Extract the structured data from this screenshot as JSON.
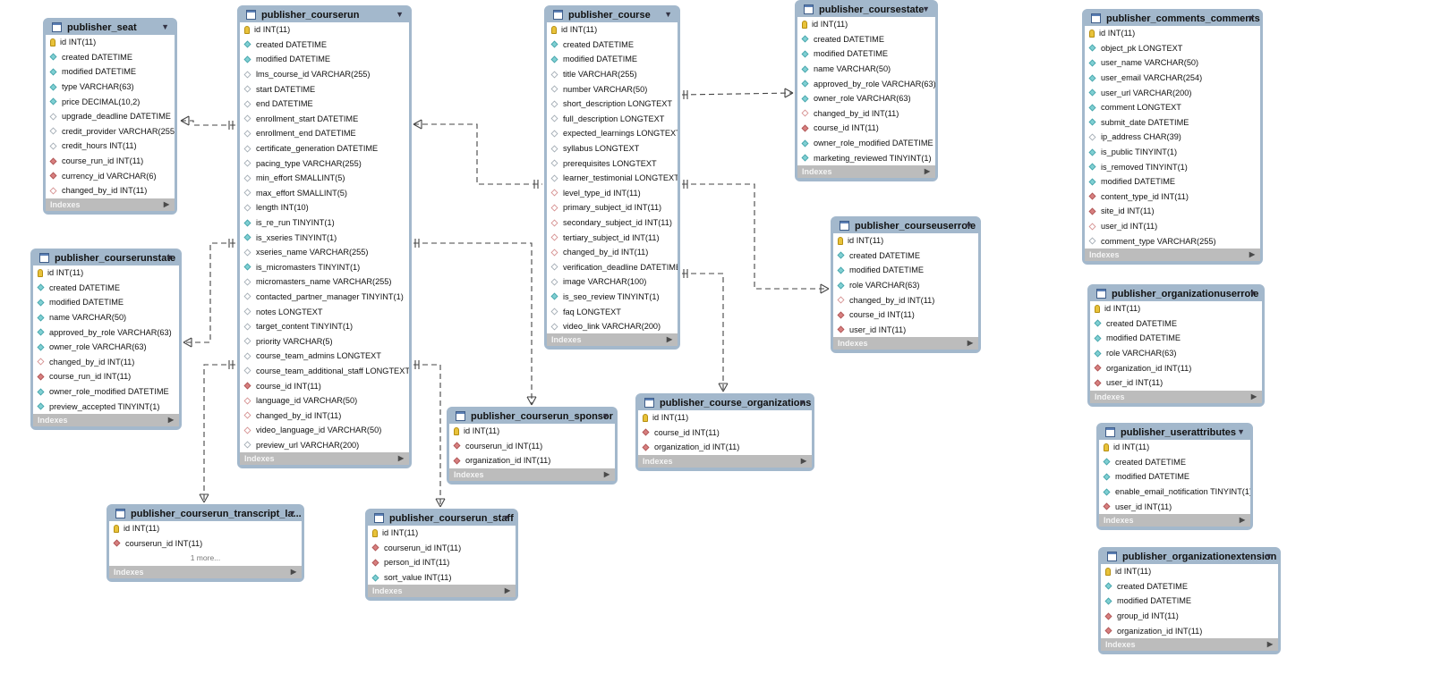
{
  "indexes_label": "Indexes",
  "tables": [
    {
      "id": "seat",
      "name": "publisher_seat",
      "columns": [
        {
          "t": "pk",
          "text": "id INT(11)"
        },
        {
          "t": "nn",
          "text": "created DATETIME"
        },
        {
          "t": "nn",
          "text": "modified DATETIME"
        },
        {
          "t": "nn",
          "text": "type VARCHAR(63)"
        },
        {
          "t": "nn",
          "text": "price DECIMAL(10,2)"
        },
        {
          "t": "col",
          "text": "upgrade_deadline DATETIME"
        },
        {
          "t": "col",
          "text": "credit_provider VARCHAR(255)"
        },
        {
          "t": "col",
          "text": "credit_hours INT(11)"
        },
        {
          "t": "fk",
          "text": "course_run_id INT(11)"
        },
        {
          "t": "fk",
          "text": "currency_id VARCHAR(6)"
        },
        {
          "t": "fkn",
          "text": "changed_by_id INT(11)"
        }
      ]
    },
    {
      "id": "courserun",
      "name": "publisher_courserun",
      "columns": [
        {
          "t": "pk",
          "text": "id INT(11)"
        },
        {
          "t": "nn",
          "text": "created DATETIME"
        },
        {
          "t": "nn",
          "text": "modified DATETIME"
        },
        {
          "t": "col",
          "text": "lms_course_id VARCHAR(255)"
        },
        {
          "t": "col",
          "text": "start DATETIME"
        },
        {
          "t": "col",
          "text": "end DATETIME"
        },
        {
          "t": "col",
          "text": "enrollment_start DATETIME"
        },
        {
          "t": "col",
          "text": "enrollment_end DATETIME"
        },
        {
          "t": "col",
          "text": "certificate_generation DATETIME"
        },
        {
          "t": "col",
          "text": "pacing_type VARCHAR(255)"
        },
        {
          "t": "col",
          "text": "min_effort SMALLINT(5)"
        },
        {
          "t": "col",
          "text": "max_effort SMALLINT(5)"
        },
        {
          "t": "col",
          "text": "length INT(10)"
        },
        {
          "t": "nn",
          "text": "is_re_run TINYINT(1)"
        },
        {
          "t": "nn",
          "text": "is_xseries TINYINT(1)"
        },
        {
          "t": "col",
          "text": "xseries_name VARCHAR(255)"
        },
        {
          "t": "nn",
          "text": "is_micromasters TINYINT(1)"
        },
        {
          "t": "col",
          "text": "micromasters_name VARCHAR(255)"
        },
        {
          "t": "col",
          "text": "contacted_partner_manager TINYINT(1)"
        },
        {
          "t": "col",
          "text": "notes LONGTEXT"
        },
        {
          "t": "col",
          "text": "target_content TINYINT(1)"
        },
        {
          "t": "col",
          "text": "priority VARCHAR(5)"
        },
        {
          "t": "col",
          "text": "course_team_admins LONGTEXT"
        },
        {
          "t": "col",
          "text": "course_team_additional_staff LONGTEXT"
        },
        {
          "t": "fk",
          "text": "course_id INT(11)"
        },
        {
          "t": "fkn",
          "text": "language_id VARCHAR(50)"
        },
        {
          "t": "fkn",
          "text": "changed_by_id INT(11)"
        },
        {
          "t": "fkn",
          "text": "video_language_id VARCHAR(50)"
        },
        {
          "t": "col",
          "text": "preview_url VARCHAR(200)"
        }
      ]
    },
    {
      "id": "course",
      "name": "publisher_course",
      "columns": [
        {
          "t": "pk",
          "text": "id INT(11)"
        },
        {
          "t": "nn",
          "text": "created DATETIME"
        },
        {
          "t": "nn",
          "text": "modified DATETIME"
        },
        {
          "t": "col",
          "text": "title VARCHAR(255)"
        },
        {
          "t": "col",
          "text": "number VARCHAR(50)"
        },
        {
          "t": "col",
          "text": "short_description LONGTEXT"
        },
        {
          "t": "col",
          "text": "full_description LONGTEXT"
        },
        {
          "t": "col",
          "text": "expected_learnings LONGTEXT"
        },
        {
          "t": "col",
          "text": "syllabus LONGTEXT"
        },
        {
          "t": "col",
          "text": "prerequisites LONGTEXT"
        },
        {
          "t": "col",
          "text": "learner_testimonial LONGTEXT"
        },
        {
          "t": "fkn",
          "text": "level_type_id INT(11)"
        },
        {
          "t": "fkn",
          "text": "primary_subject_id INT(11)"
        },
        {
          "t": "fkn",
          "text": "secondary_subject_id INT(11)"
        },
        {
          "t": "fkn",
          "text": "tertiary_subject_id INT(11)"
        },
        {
          "t": "fkn",
          "text": "changed_by_id INT(11)"
        },
        {
          "t": "col",
          "text": "verification_deadline DATETIME"
        },
        {
          "t": "col",
          "text": "image VARCHAR(100)"
        },
        {
          "t": "nn",
          "text": "is_seo_review TINYINT(1)"
        },
        {
          "t": "col",
          "text": "faq LONGTEXT"
        },
        {
          "t": "col",
          "text": "video_link VARCHAR(200)"
        }
      ]
    },
    {
      "id": "coursestate",
      "name": "publisher_coursestate",
      "columns": [
        {
          "t": "pk",
          "text": "id INT(11)"
        },
        {
          "t": "nn",
          "text": "created DATETIME"
        },
        {
          "t": "nn",
          "text": "modified DATETIME"
        },
        {
          "t": "nn",
          "text": "name VARCHAR(50)"
        },
        {
          "t": "nn",
          "text": "approved_by_role VARCHAR(63)"
        },
        {
          "t": "nn",
          "text": "owner_role VARCHAR(63)"
        },
        {
          "t": "fkn",
          "text": "changed_by_id INT(11)"
        },
        {
          "t": "fk",
          "text": "course_id INT(11)"
        },
        {
          "t": "nn",
          "text": "owner_role_modified DATETIME"
        },
        {
          "t": "nn",
          "text": "marketing_reviewed TINYINT(1)"
        }
      ]
    },
    {
      "id": "comments",
      "name": "publisher_comments_comments",
      "columns": [
        {
          "t": "pk",
          "text": "id INT(11)"
        },
        {
          "t": "nn",
          "text": "object_pk LONGTEXT"
        },
        {
          "t": "nn",
          "text": "user_name VARCHAR(50)"
        },
        {
          "t": "nn",
          "text": "user_email VARCHAR(254)"
        },
        {
          "t": "nn",
          "text": "user_url VARCHAR(200)"
        },
        {
          "t": "nn",
          "text": "comment LONGTEXT"
        },
        {
          "t": "nn",
          "text": "submit_date DATETIME"
        },
        {
          "t": "col",
          "text": "ip_address CHAR(39)"
        },
        {
          "t": "nn",
          "text": "is_public TINYINT(1)"
        },
        {
          "t": "nn",
          "text": "is_removed TINYINT(1)"
        },
        {
          "t": "nn",
          "text": "modified DATETIME"
        },
        {
          "t": "fk",
          "text": "content_type_id INT(11)"
        },
        {
          "t": "fk",
          "text": "site_id INT(11)"
        },
        {
          "t": "fkn",
          "text": "user_id INT(11)"
        },
        {
          "t": "col",
          "text": "comment_type VARCHAR(255)"
        }
      ]
    },
    {
      "id": "courserunstate",
      "name": "publisher_courserunstate",
      "columns": [
        {
          "t": "pk",
          "text": "id INT(11)"
        },
        {
          "t": "nn",
          "text": "created DATETIME"
        },
        {
          "t": "nn",
          "text": "modified DATETIME"
        },
        {
          "t": "nn",
          "text": "name VARCHAR(50)"
        },
        {
          "t": "nn",
          "text": "approved_by_role VARCHAR(63)"
        },
        {
          "t": "nn",
          "text": "owner_role VARCHAR(63)"
        },
        {
          "t": "fkn",
          "text": "changed_by_id INT(11)"
        },
        {
          "t": "fk",
          "text": "course_run_id INT(11)"
        },
        {
          "t": "nn",
          "text": "owner_role_modified DATETIME"
        },
        {
          "t": "nn",
          "text": "preview_accepted TINYINT(1)"
        }
      ]
    },
    {
      "id": "courseuserrole",
      "name": "publisher_courseuserrole",
      "columns": [
        {
          "t": "pk",
          "text": "id INT(11)"
        },
        {
          "t": "nn",
          "text": "created DATETIME"
        },
        {
          "t": "nn",
          "text": "modified DATETIME"
        },
        {
          "t": "nn",
          "text": "role VARCHAR(63)"
        },
        {
          "t": "fkn",
          "text": "changed_by_id INT(11)"
        },
        {
          "t": "fk",
          "text": "course_id INT(11)"
        },
        {
          "t": "fk",
          "text": "user_id INT(11)"
        }
      ]
    },
    {
      "id": "orguserrole",
      "name": "publisher_organizationuserrole",
      "columns": [
        {
          "t": "pk",
          "text": "id INT(11)"
        },
        {
          "t": "nn",
          "text": "created DATETIME"
        },
        {
          "t": "nn",
          "text": "modified DATETIME"
        },
        {
          "t": "nn",
          "text": "role VARCHAR(63)"
        },
        {
          "t": "fk",
          "text": "organization_id INT(11)"
        },
        {
          "t": "fk",
          "text": "user_id INT(11)"
        }
      ]
    },
    {
      "id": "userattr",
      "name": "publisher_userattributes",
      "columns": [
        {
          "t": "pk",
          "text": "id INT(11)"
        },
        {
          "t": "nn",
          "text": "created DATETIME"
        },
        {
          "t": "nn",
          "text": "modified DATETIME"
        },
        {
          "t": "nn",
          "text": "enable_email_notification TINYINT(1)"
        },
        {
          "t": "fk",
          "text": "user_id INT(11)"
        }
      ]
    },
    {
      "id": "orgext",
      "name": "publisher_organizationextension",
      "columns": [
        {
          "t": "pk",
          "text": "id INT(11)"
        },
        {
          "t": "nn",
          "text": "created DATETIME"
        },
        {
          "t": "nn",
          "text": "modified DATETIME"
        },
        {
          "t": "fk",
          "text": "group_id INT(11)"
        },
        {
          "t": "fk",
          "text": "organization_id INT(11)"
        }
      ]
    },
    {
      "id": "sponsor",
      "name": "publisher_courserun_sponsor",
      "columns": [
        {
          "t": "pk",
          "text": "id INT(11)"
        },
        {
          "t": "fk",
          "text": "courserun_id INT(11)"
        },
        {
          "t": "fk",
          "text": "organization_id INT(11)"
        }
      ]
    },
    {
      "id": "courseorgs",
      "name": "publisher_course_organizations",
      "columns": [
        {
          "t": "pk",
          "text": "id INT(11)"
        },
        {
          "t": "fk",
          "text": "course_id INT(11)"
        },
        {
          "t": "fk",
          "text": "organization_id INT(11)"
        }
      ]
    },
    {
      "id": "transcript",
      "name": "publisher_courserun_transcript_la...",
      "more": "1 more...",
      "columns": [
        {
          "t": "pk",
          "text": "id INT(11)"
        },
        {
          "t": "fk",
          "text": "courserun_id INT(11)"
        }
      ]
    },
    {
      "id": "staff",
      "name": "publisher_courserun_staff",
      "columns": [
        {
          "t": "pk",
          "text": "id INT(11)"
        },
        {
          "t": "fk",
          "text": "courserun_id INT(11)"
        },
        {
          "t": "fk",
          "text": "person_id INT(11)"
        },
        {
          "t": "nn",
          "text": "sort_value INT(11)"
        }
      ]
    }
  ]
}
